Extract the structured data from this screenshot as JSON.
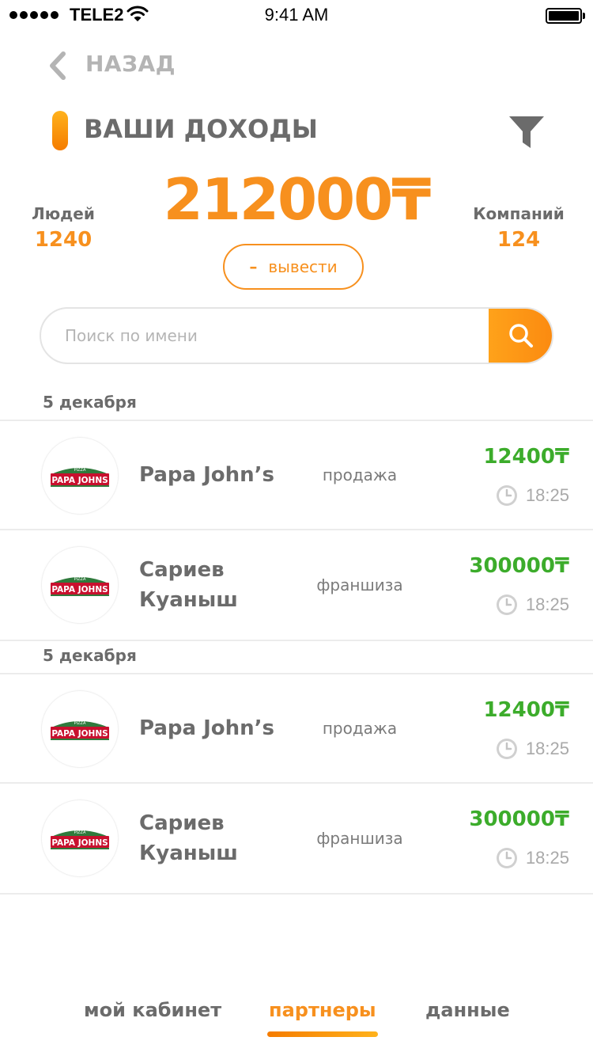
{
  "status_bar": {
    "carrier": "TELE2",
    "time": "9:41 AM"
  },
  "header": {
    "back_label": "НАЗАД",
    "title": "ВАШИ ДОХОДЫ"
  },
  "stats": {
    "people_label": "Людей",
    "people_value": "1240",
    "total": "212000₸",
    "companies_label": "Компаний",
    "companies_value": "124",
    "withdraw_label": "вывести"
  },
  "search": {
    "placeholder": "Поиск по имени"
  },
  "groups": [
    {
      "date": "5 декабря",
      "items": [
        {
          "name": "Papa John’s",
          "type": "продажа",
          "amount": "12400₸",
          "time": "18:25"
        },
        {
          "name": "Сариев Куаныш",
          "type": "франшиза",
          "amount": "300000₸",
          "time": "18:25"
        }
      ]
    },
    {
      "date": "5 декабря",
      "items": [
        {
          "name": "Papa John’s",
          "type": "продажа",
          "amount": "12400₸",
          "time": "18:25"
        },
        {
          "name": "Сариев Куаныш",
          "type": "франшиза",
          "amount": "300000₸",
          "time": "18:25"
        }
      ]
    }
  ],
  "logo": {
    "top_text": "PIZZA",
    "main_text": "PAPA JOHNS"
  },
  "nav": {
    "cabinet": "мой кабинет",
    "partners": "партнеры",
    "data": "данные"
  },
  "colors": {
    "accent": "#f7901e",
    "positive": "#3cac2b",
    "text": "#6b6b6b"
  }
}
